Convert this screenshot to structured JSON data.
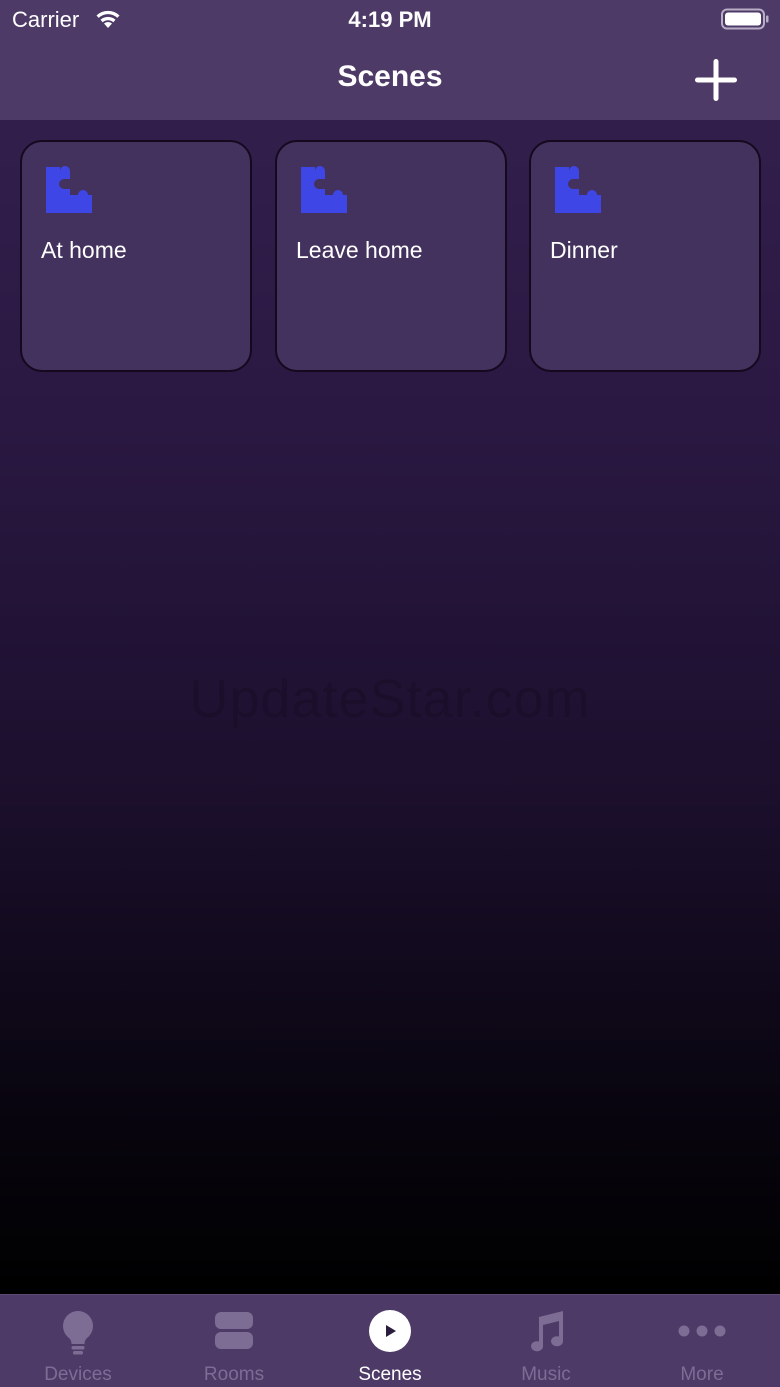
{
  "status_bar": {
    "carrier": "Carrier",
    "time": "4:19 PM"
  },
  "nav_bar": {
    "title": "Scenes",
    "add_icon": "plus-icon"
  },
  "scenes": [
    {
      "label": "At home",
      "icon": "puzzle-piece-icon"
    },
    {
      "label": "Leave home",
      "icon": "puzzle-piece-icon"
    },
    {
      "label": "Dinner",
      "icon": "puzzle-piece-icon"
    }
  ],
  "watermark": "UpdateStar.com",
  "tab_bar": {
    "tabs": [
      {
        "label": "Devices",
        "icon": "lightbulb-icon",
        "active": false
      },
      {
        "label": "Rooms",
        "icon": "rooms-icon",
        "active": false
      },
      {
        "label": "Scenes",
        "icon": "play-circle-icon",
        "active": true
      },
      {
        "label": "Music",
        "icon": "music-note-icon",
        "active": false
      },
      {
        "label": "More",
        "icon": "more-dots-icon",
        "active": false
      }
    ]
  },
  "colors": {
    "bar_background": "#4e3a67",
    "tile_background": "#44325e",
    "icon_accent": "#3f46e6",
    "tab_inactive": "#7d6c93",
    "tab_active": "#ffffff"
  }
}
